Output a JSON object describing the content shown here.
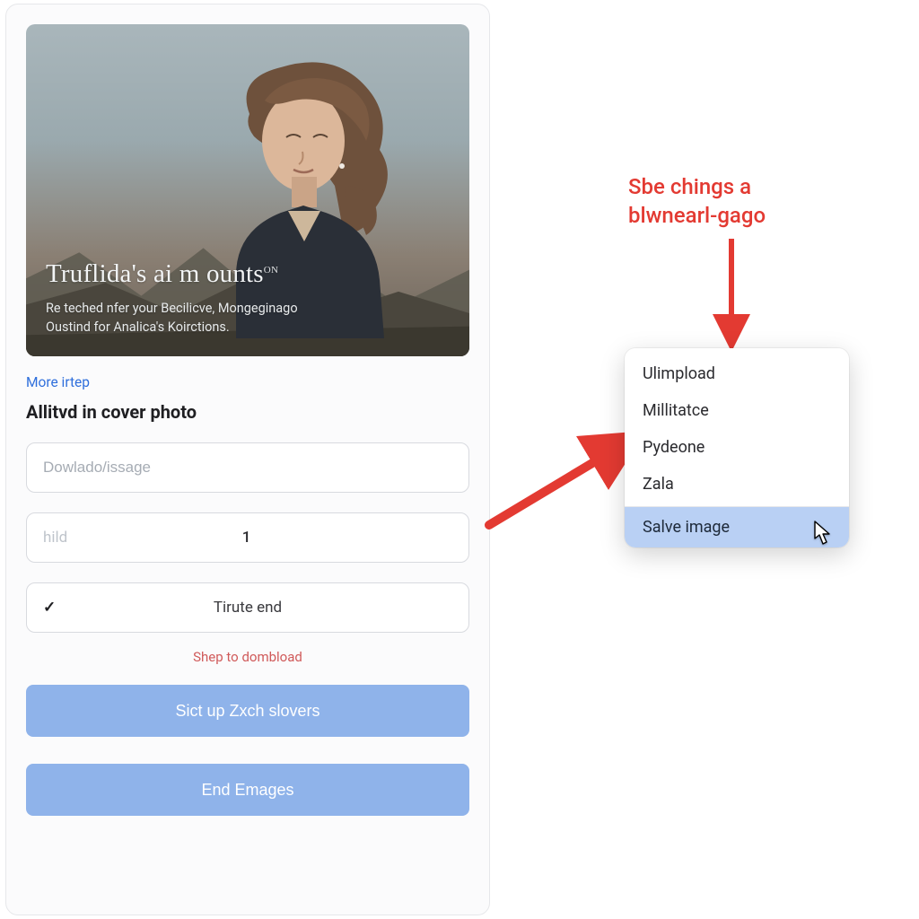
{
  "cover": {
    "title_html": "Truflida's ai m ounts",
    "title_sup": "ON",
    "subtitle_line1": "Re teched nfer your Becilicve, Mongeginago",
    "subtitle_line2": "Oustind for Analica's Koirctions."
  },
  "links": {
    "more": "More irtep",
    "warn": "Shep to dombload"
  },
  "section": {
    "title": "Allitvd in cover photo"
  },
  "fields": {
    "download_placeholder": "Dowlado/issage",
    "hild_label": "hild",
    "hild_value": "1",
    "check_label": "Tirute end"
  },
  "buttons": {
    "primary": "Sict up Zxch slovers",
    "secondary": "End Emages"
  },
  "annotation": {
    "line1": "Sbe chings a",
    "line2": "blwnearl-gago"
  },
  "menu": {
    "items": [
      "Ulimpload",
      "Millitatce",
      "Pydeone",
      "Zala"
    ],
    "highlighted": "Salve image"
  }
}
